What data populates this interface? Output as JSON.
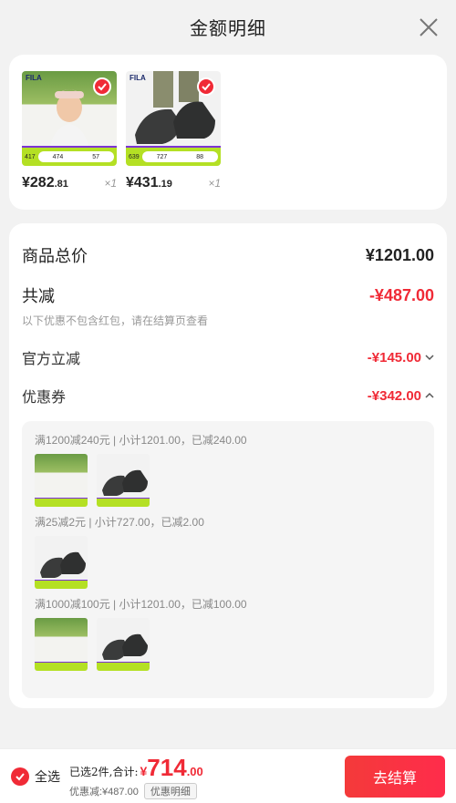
{
  "header": {
    "title": "金额明细"
  },
  "products": [
    {
      "brand": "FILA",
      "tag_left": "417",
      "tag_mid": "474",
      "tag_right": "57",
      "price_int": "¥282",
      "price_dec": ".81",
      "qty": "×1"
    },
    {
      "brand": "FILA",
      "tag_left": "639",
      "tag_mid": "727",
      "tag_right": "88",
      "price_int": "¥431",
      "price_dec": ".19",
      "qty": "×1"
    }
  ],
  "summary": {
    "total_label": "商品总价",
    "total_value": "¥1201.00",
    "discount_label": "共减",
    "discount_value": "-¥487.00",
    "discount_note": "以下优惠不包含红包，请在结算页查看",
    "official_label": "官方立减",
    "official_value": "-¥145.00",
    "coupon_label": "优惠券",
    "coupon_value": "-¥342.00"
  },
  "coupon_rules": [
    "满1200减240元 | 小计1201.00，已减240.00",
    "满25减2元 | 小计727.00，已减2.00",
    "满1000减100元 | 小计1201.00，已减100.00"
  ],
  "bottom": {
    "select_all": "全选",
    "selected_text": "已选2件,合计:",
    "currency": "¥",
    "total_int": "714",
    "total_dec": ".00",
    "discount_text": "优惠减:¥487.00",
    "detail_chip": "优惠明细",
    "checkout": "去结算"
  },
  "colors": {
    "accent": "#f02a36",
    "tag_green": "#b4e024",
    "tag_purple": "#7c34d4"
  },
  "icons": {
    "close": "close-icon",
    "check": "check-icon",
    "chevron_down": "chevron-down-icon",
    "chevron_up": "chevron-up-icon"
  }
}
